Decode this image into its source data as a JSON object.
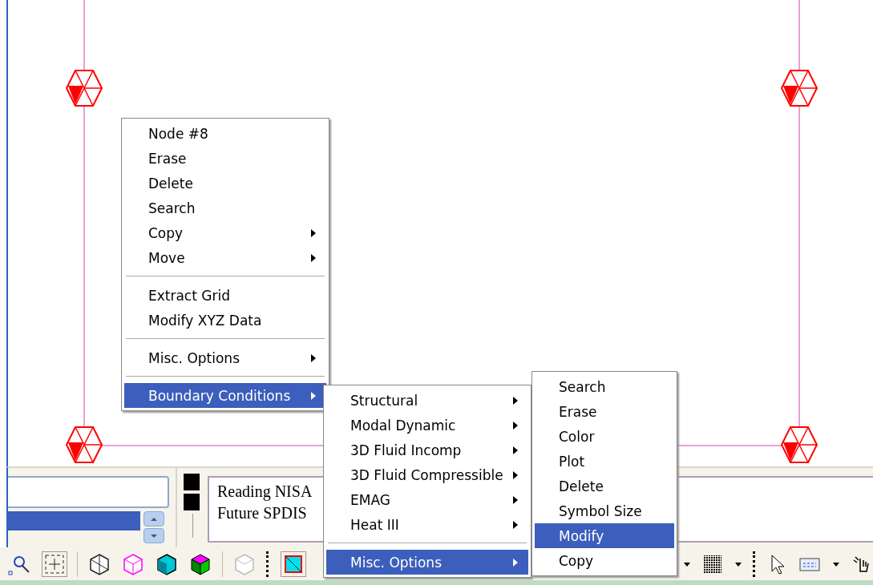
{
  "menus": [
    {
      "items": [
        {
          "kind": "item",
          "label": "Node #8",
          "submenu": false,
          "selected": false
        },
        {
          "kind": "item",
          "label": "Erase",
          "submenu": false,
          "selected": false
        },
        {
          "kind": "item",
          "label": "Delete",
          "submenu": false,
          "selected": false
        },
        {
          "kind": "item",
          "label": "Search",
          "submenu": false,
          "selected": false
        },
        {
          "kind": "item",
          "label": "Copy",
          "submenu": true,
          "selected": false
        },
        {
          "kind": "item",
          "label": "Move",
          "submenu": true,
          "selected": false
        },
        {
          "kind": "separator"
        },
        {
          "kind": "item",
          "label": "Extract Grid",
          "submenu": false,
          "selected": false
        },
        {
          "kind": "item",
          "label": "Modify XYZ Data",
          "submenu": false,
          "selected": false
        },
        {
          "kind": "separator"
        },
        {
          "kind": "item",
          "label": "Misc. Options",
          "submenu": true,
          "selected": false
        },
        {
          "kind": "separator"
        },
        {
          "kind": "item",
          "label": "Boundary Conditions",
          "submenu": true,
          "selected": true
        }
      ]
    },
    {
      "items": [
        {
          "kind": "item",
          "label": "Structural",
          "submenu": true,
          "selected": false
        },
        {
          "kind": "item",
          "label": "Modal Dynamic",
          "submenu": true,
          "selected": false
        },
        {
          "kind": "item",
          "label": "3D Fluid Incomp",
          "submenu": true,
          "selected": false
        },
        {
          "kind": "item",
          "label": "3D Fluid Compressible",
          "submenu": true,
          "selected": false
        },
        {
          "kind": "item",
          "label": "EMAG",
          "submenu": true,
          "selected": false
        },
        {
          "kind": "item",
          "label": "Heat III",
          "submenu": true,
          "selected": false
        },
        {
          "kind": "separator"
        },
        {
          "kind": "item",
          "label": "Misc. Options",
          "submenu": true,
          "selected": true
        }
      ]
    },
    {
      "items": [
        {
          "kind": "item",
          "label": "Search",
          "submenu": false,
          "selected": false
        },
        {
          "kind": "item",
          "label": "Erase",
          "submenu": false,
          "selected": false
        },
        {
          "kind": "item",
          "label": "Color",
          "submenu": false,
          "selected": false
        },
        {
          "kind": "item",
          "label": "Plot",
          "submenu": false,
          "selected": false
        },
        {
          "kind": "item",
          "label": "Delete",
          "submenu": false,
          "selected": false
        },
        {
          "kind": "item",
          "label": "Symbol Size",
          "submenu": false,
          "selected": false
        },
        {
          "kind": "item",
          "label": "Modify",
          "submenu": false,
          "selected": true
        },
        {
          "kind": "item",
          "label": "Copy",
          "submenu": false,
          "selected": false
        }
      ]
    }
  ],
  "messages": [
    "Reading NISA",
    "Future SPDIS"
  ]
}
